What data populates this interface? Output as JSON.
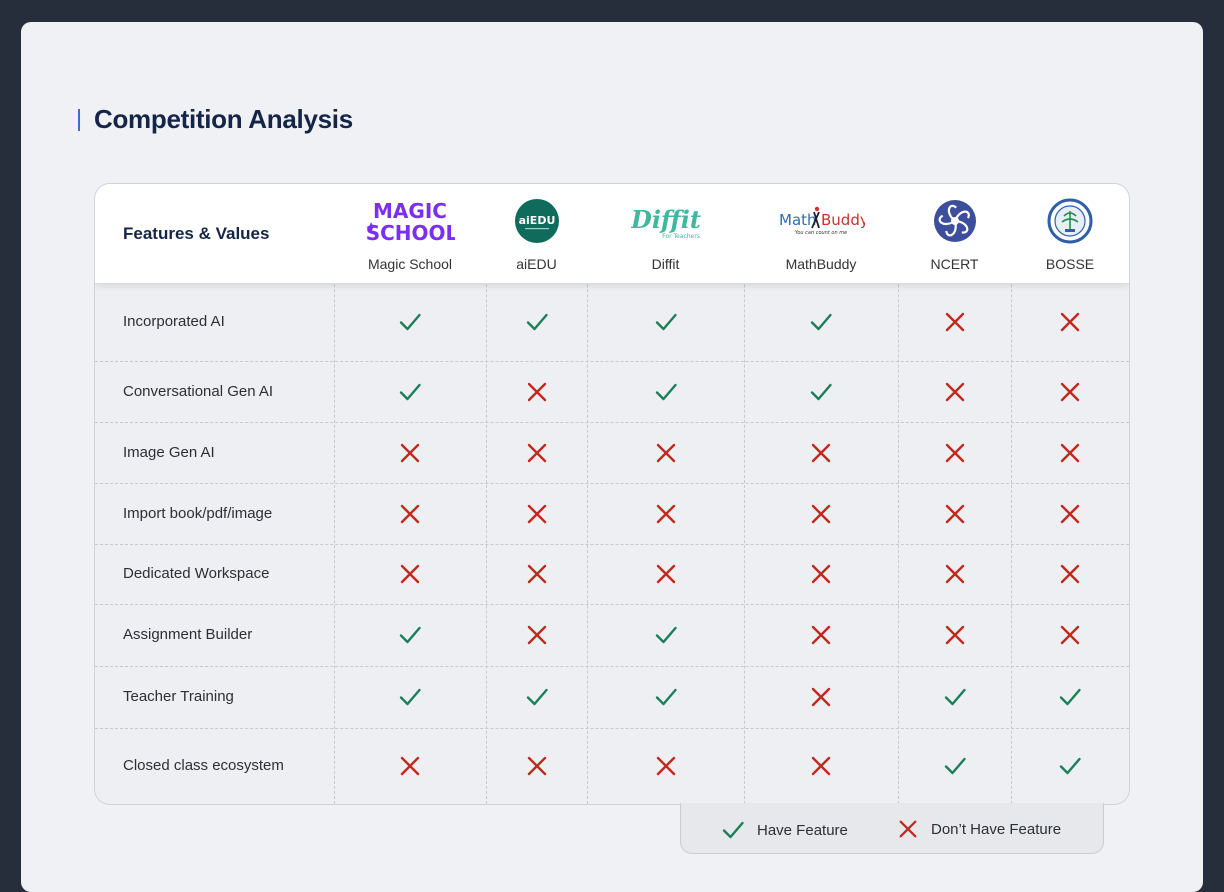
{
  "title": "Competition Analysis",
  "table": {
    "header_label": "Features & Values",
    "brands": [
      {
        "name": "Magic School",
        "logo": "magic-school-logo",
        "logo_text": [
          "MAGIC",
          "SCHOOL"
        ]
      },
      {
        "name": "aiEDU",
        "logo": "aiedu-logo",
        "logo_text": [
          "aiEDU"
        ]
      },
      {
        "name": "Diffit",
        "logo": "diffit-logo",
        "logo_text": [
          "Diffit",
          "For Teachers"
        ]
      },
      {
        "name": "MathBuddy",
        "logo": "mathbuddy-logo",
        "logo_text": [
          "Math",
          "Buddy",
          "You can count on me"
        ]
      },
      {
        "name": "NCERT",
        "logo": "ncert-logo",
        "logo_text": []
      },
      {
        "name": "BOSSE",
        "logo": "bosse-logo",
        "logo_text": []
      }
    ],
    "rows": [
      {
        "feature": "Incorporated AI",
        "values": [
          true,
          true,
          true,
          true,
          false,
          false
        ]
      },
      {
        "feature": "Conversational Gen AI",
        "values": [
          true,
          false,
          true,
          true,
          false,
          false
        ]
      },
      {
        "feature": "Image Gen AI",
        "values": [
          false,
          false,
          false,
          false,
          false,
          false
        ]
      },
      {
        "feature": "Import book/pdf/image",
        "values": [
          false,
          false,
          false,
          false,
          false,
          false
        ]
      },
      {
        "feature": "Dedicated Workspace",
        "values": [
          false,
          false,
          false,
          false,
          false,
          false
        ]
      },
      {
        "feature": "Assignment Builder",
        "values": [
          true,
          false,
          true,
          false,
          false,
          false
        ]
      },
      {
        "feature": "Teacher Training",
        "values": [
          true,
          true,
          true,
          false,
          true,
          true
        ]
      },
      {
        "feature": "Closed class ecosystem",
        "values": [
          false,
          false,
          false,
          false,
          true,
          true
        ]
      }
    ]
  },
  "legend": {
    "have": "Have Feature",
    "dont_have": "Don’t Have Feature"
  },
  "colors": {
    "check": "#1b7f57",
    "cross": "#c0291d",
    "title": "#152547",
    "accent": "#3b6fd1"
  },
  "icons": {
    "check": "check-icon",
    "cross": "cross-icon"
  }
}
